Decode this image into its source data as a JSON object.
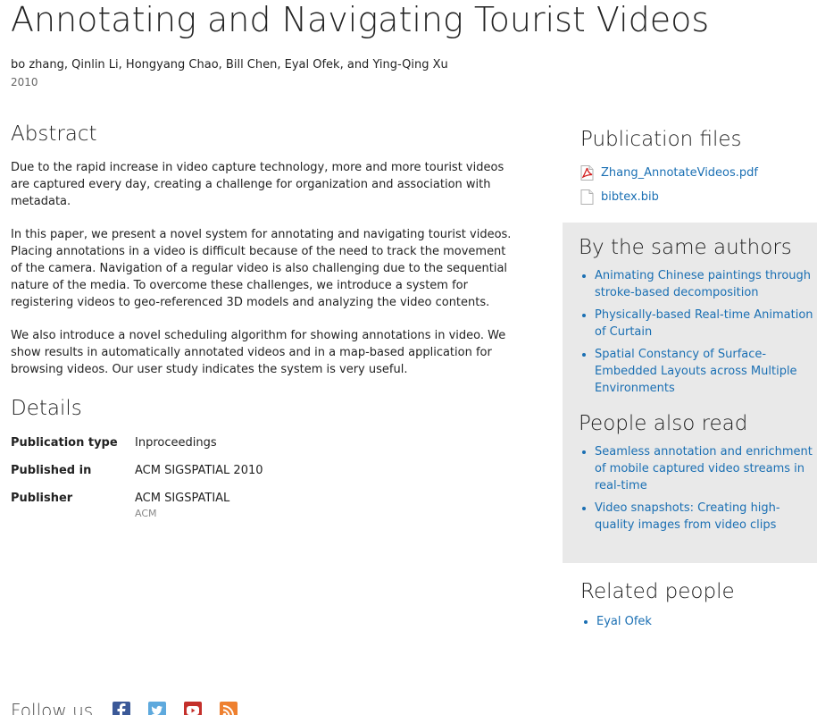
{
  "header": {
    "title": "Annotating and Navigating Tourist Videos",
    "authors": "bo zhang, Qinlin Li, Hongyang Chao, Bill Chen, Eyal Ofek, and Ying-Qing Xu",
    "year": "2010"
  },
  "abstract": {
    "heading": "Abstract",
    "paragraphs": [
      "Due to the rapid increase in video capture technology, more and more tourist videos are captured every day, creating a challenge for organization and association with metadata.",
      "In this paper, we present a novel system for annotating and navigating tourist videos. Placing annotations in a video is difficult because of the need to track the movement of the camera. Navigation of a regular video is also challenging due to the sequential nature of the media. To overcome these challenges, we introduce a system for registering videos to geo-referenced 3D models and analyzing the video contents.",
      "We also introduce a novel scheduling algorithm for showing annotations in video. We show results in automatically annotated videos and in a map-based application for browsing videos. Our user study indicates the system is very useful."
    ]
  },
  "details": {
    "heading": "Details",
    "rows": [
      {
        "label": "Publication type",
        "value": "Inproceedings",
        "sub": ""
      },
      {
        "label": "Published in",
        "value": "ACM SIGSPATIAL 2010",
        "sub": ""
      },
      {
        "label": "Publisher",
        "value": "ACM SIGSPATIAL",
        "sub": "ACM"
      }
    ]
  },
  "files": {
    "heading": "Publication files",
    "items": [
      {
        "name": "Zhang_AnnotateVideos.pdf",
        "icon": "pdf-file-icon"
      },
      {
        "name": "bibtex.bib",
        "icon": "document-file-icon"
      }
    ]
  },
  "same_authors": {
    "heading": "By the same authors",
    "items": [
      "Animating Chinese paintings through stroke-based decomposition",
      "Physically-based Real-time Animation of Curtain",
      "Spatial Constancy of Surface-Embedded Layouts across Multiple Environments"
    ]
  },
  "also_read": {
    "heading": "People also read",
    "items": [
      "Seamless annotation and enrichment of mobile captured video streams in real-time",
      "Video snapshots: Creating high-quality images from video clips"
    ]
  },
  "related_people": {
    "heading": "Related people",
    "items": [
      "Eyal Ofek"
    ]
  },
  "follow": {
    "label": "Follow us",
    "icons": [
      "facebook-icon",
      "twitter-icon",
      "youtube-icon",
      "rss-icon"
    ]
  },
  "colors": {
    "link": "#1a6fb3",
    "sidebar_bg": "#e9e9e9",
    "text": "#222222",
    "muted": "#666666"
  }
}
